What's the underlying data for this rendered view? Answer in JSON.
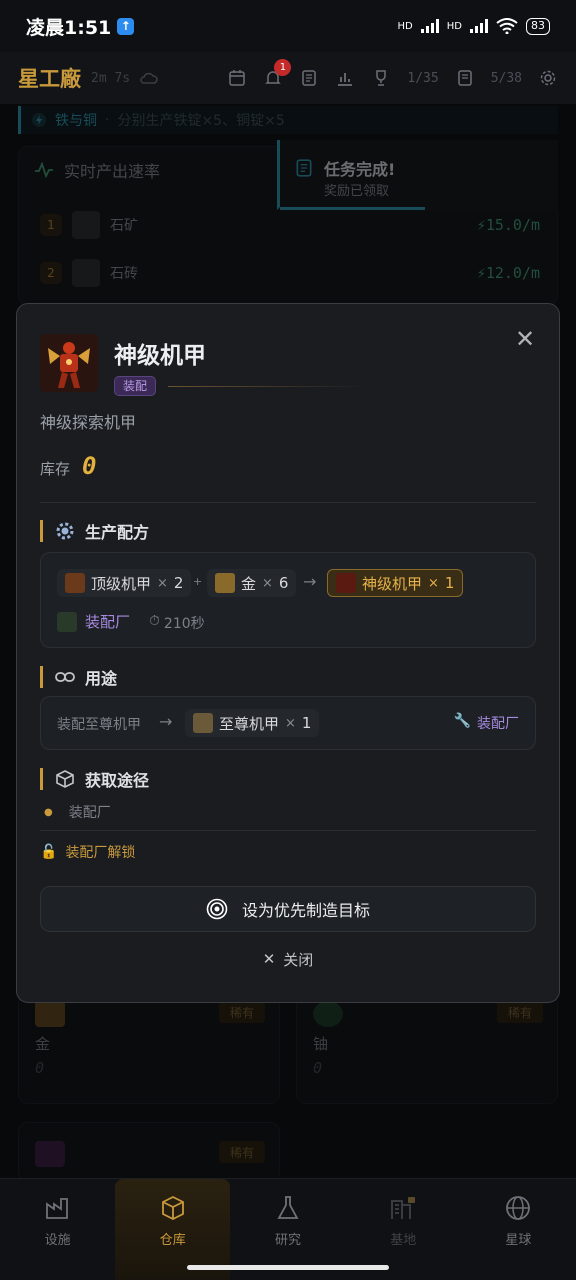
{
  "status": {
    "time": "凌晨1:51",
    "up_icon": "↑",
    "net1": "HD",
    "net2": "HD",
    "battery": "83"
  },
  "topbar": {
    "logo": "星工廠",
    "timer": "2m 7s",
    "notif_count": "1",
    "trophy": "1/35",
    "scroll": "5/38"
  },
  "quest": {
    "title": "铁与铜",
    "sep": "·",
    "desc": "分别生产铁锭×5、铜锭×5"
  },
  "panel": {
    "title": "实时产出速率",
    "rows": [
      {
        "rank": "1",
        "name": "石矿",
        "rate": "15.0/m"
      },
      {
        "rank": "2",
        "name": "石砖",
        "rate": "12.0/m"
      }
    ]
  },
  "toast": {
    "title": "任务完成!",
    "sub": "奖励已领取"
  },
  "bgcards": [
    {
      "badge": "稀有",
      "name": "金",
      "qty": "0"
    },
    {
      "badge": "稀有",
      "name": "铀",
      "qty": "0"
    },
    {
      "badge": "稀有"
    }
  ],
  "modal": {
    "title": "神级机甲",
    "tag": "装配",
    "desc": "神级探索机甲",
    "stock_label": "库存",
    "stock_value": "0",
    "recipe": {
      "title": "生产配方",
      "inputs": [
        {
          "name": "顶级机甲",
          "x": "×",
          "qty": "2"
        },
        {
          "name": "金",
          "x": "×",
          "qty": "6"
        }
      ],
      "plus": "+",
      "arrow": "→",
      "output": {
        "name": "神级机甲",
        "x": "×",
        "qty": "1"
      },
      "facility": "装配厂",
      "time": "210秒"
    },
    "usage": {
      "title": "用途",
      "label": "装配至尊机甲",
      "arrow": "→",
      "target": {
        "name": "至尊机甲",
        "x": "×",
        "qty": "1"
      },
      "facility": "装配厂"
    },
    "source": {
      "title": "获取途径",
      "item": "装配厂",
      "unlock": "装配厂解锁"
    },
    "priority_button": "设为优先制造目标",
    "close_button": "关闭"
  },
  "nav": [
    {
      "label": "设施"
    },
    {
      "label": "仓库"
    },
    {
      "label": "研究"
    },
    {
      "label": "基地"
    },
    {
      "label": "星球"
    }
  ],
  "colors": {
    "accent": "#c99a3b",
    "teal": "#2a8aa0",
    "purple": "#a78ae0",
    "gold": "#e4b23c",
    "green": "#3f8f6c"
  }
}
